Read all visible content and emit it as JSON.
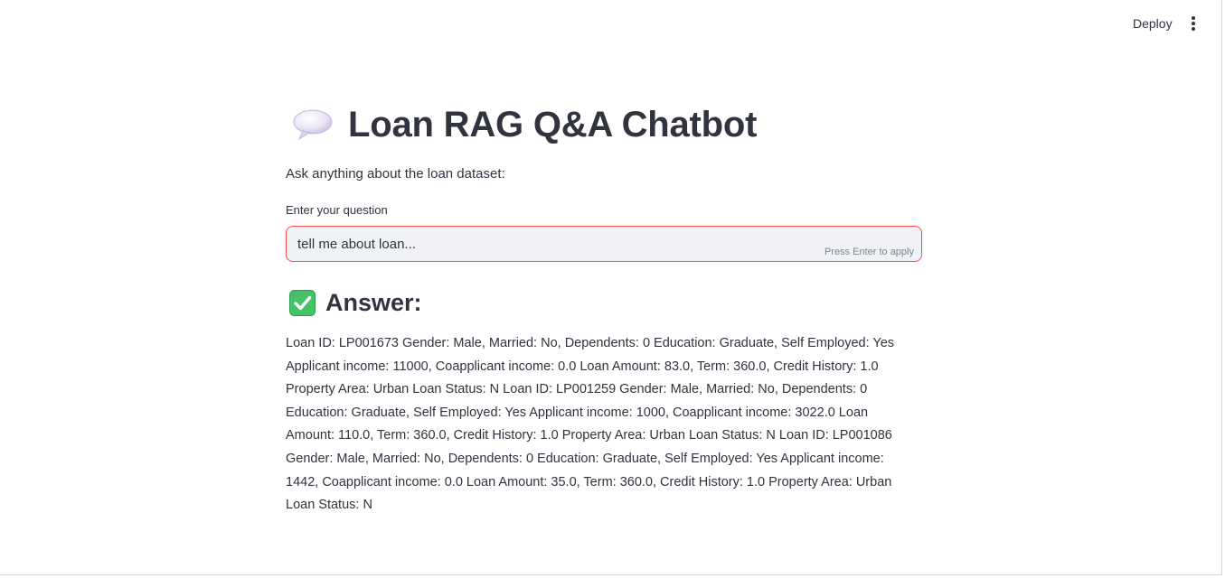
{
  "header": {
    "deploy_label": "Deploy"
  },
  "main": {
    "title": "Loan RAG Q&A Chatbot",
    "title_icon": "speech-balloon-icon",
    "subtitle": "Ask anything about the loan dataset:",
    "question": {
      "label": "Enter your question",
      "value": "tell me about loan...",
      "hint": "Press Enter to apply"
    },
    "answer_heading": "Answer:",
    "answer_icon": "check-mark-button-icon",
    "answer_text": "Loan ID: LP001673 Gender: Male, Married: No, Dependents: 0 Education: Graduate, Self Employed: Yes Applicant income: 11000, Coapplicant income: 0.0 Loan Amount: 83.0, Term: 360.0, Credit History: 1.0 Property Area: Urban Loan Status: N Loan ID: LP001259 Gender: Male, Married: No, Dependents: 0 Education: Graduate, Self Employed: Yes Applicant income: 1000, Coapplicant income: 3022.0 Loan Amount: 110.0, Term: 360.0, Credit History: 1.0 Property Area: Urban Loan Status: N Loan ID: LP001086 Gender: Male, Married: No, Dependents: 0 Education: Graduate, Self Employed: Yes Applicant income: 1442, Coapplicant income: 0.0 Loan Amount: 35.0, Term: 360.0, Credit History: 1.0 Property Area: Urban Loan Status: N"
  },
  "colors": {
    "text": "#31333f",
    "accent_border": "#ff4b4b",
    "input_bg": "#f0f2f6",
    "check_green": "#3fbf5f"
  }
}
